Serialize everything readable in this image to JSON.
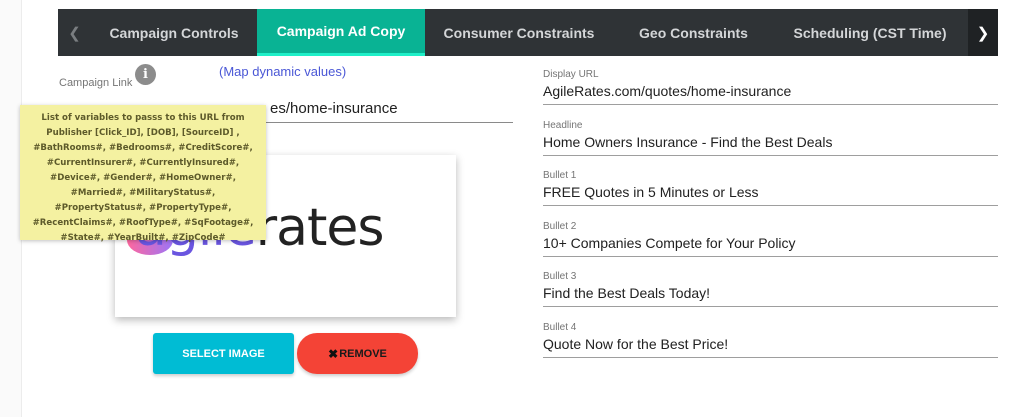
{
  "tabs": {
    "prev_icon": "chevron-left-icon",
    "next_icon": "chevron-right-icon",
    "items": [
      {
        "label": "Campaign Controls",
        "active": false
      },
      {
        "label": "Campaign Ad Copy",
        "active": true
      },
      {
        "label": "Consumer Constraints",
        "active": false
      },
      {
        "label": "Geo Constraints",
        "active": false
      },
      {
        "label": "Scheduling (CST Time)",
        "active": false
      }
    ],
    "active_color": "#09b394",
    "bar_color": "#2f3336"
  },
  "campaign_link": {
    "label": "Campaign Link",
    "info_icon": "info-icon",
    "map_dynamic_link": "(Map dynamic values)",
    "value_visible": "es/home-insurance"
  },
  "tooltip": {
    "text": "List of variables to passs to this URL from Publisher [Click_ID], [DOB], [SourceID] , #BathRooms#, #Bedrooms#, #CreditScore#, #CurrentInsurer#, #CurrentlyInsured#, #Device#, #Gender#, #HomeOwner#, #Married#, #MilitaryStatus#, #PropertyStatus#, #PropertyType#, #RecentClaims#, #RoofType#, #SqFootage#, #State#, #YearBuilt#, #ZipCode#",
    "background": "#f4f1a1"
  },
  "image": {
    "logo_agile": "agile",
    "logo_rates": "rates"
  },
  "buttons": {
    "select_image": "SELECT IMAGE",
    "remove": "REMOVE",
    "remove_icon": "close-icon",
    "select_color": "#00bcd4",
    "remove_color": "#f44336"
  },
  "fields": {
    "display_url": {
      "label": "Display URL",
      "value": "AgileRates.com/quotes/home-insurance"
    },
    "headline": {
      "label": "Headline",
      "value": "Home Owners Insurance - Find the Best Deals"
    },
    "bullet1": {
      "label": "Bullet 1",
      "value": "FREE Quotes in 5 Minutes or Less"
    },
    "bullet2": {
      "label": "Bullet 2",
      "value": "10+ Companies Compete for Your Policy"
    },
    "bullet3": {
      "label": "Bullet 3",
      "value": "Find the Best Deals Today!"
    },
    "bullet4": {
      "label": "Bullet 4",
      "value": "Quote Now for the Best Price!"
    }
  }
}
